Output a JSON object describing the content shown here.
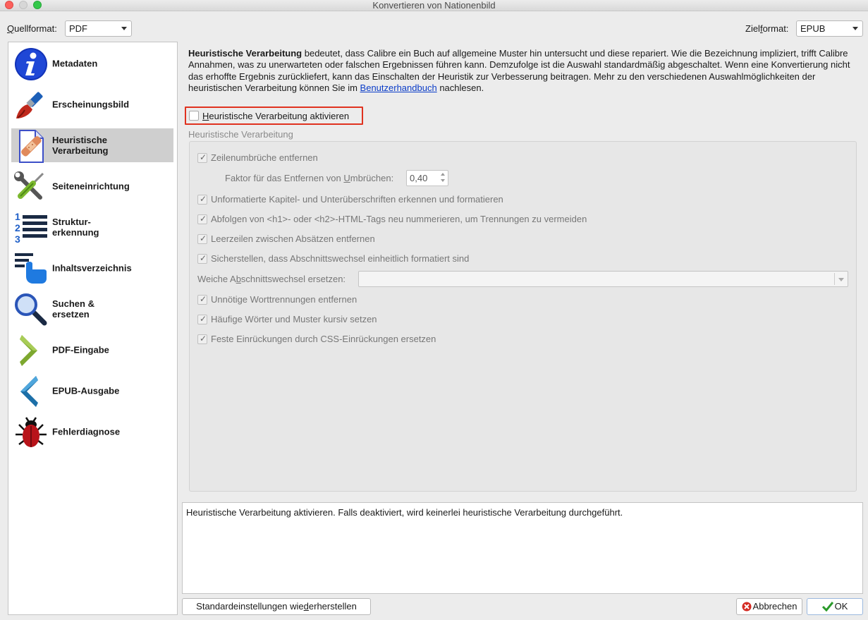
{
  "window": {
    "title": "Konvertieren von Nationenbild"
  },
  "formats": {
    "source_label_accel": "Q",
    "source_label_rest": "uellformat:",
    "source_value": "PDF",
    "target_label_pre": "Ziel",
    "target_label_accel": "f",
    "target_label_post": "ormat:",
    "target_value": "EPUB"
  },
  "sidebar": {
    "items": [
      {
        "label": "Metadaten",
        "icon": "info-icon"
      },
      {
        "label": "Erscheinungsbild",
        "icon": "paintbrush-icon"
      },
      {
        "label": "Heuristische\nVerarbeitung",
        "icon": "bandaged-page-icon",
        "selected": true
      },
      {
        "label": "Seiteneinrichtung",
        "icon": "wrench-screwdriver-icon"
      },
      {
        "label": "Struktur-\nerkennung",
        "icon": "numbered-list-icon"
      },
      {
        "label": "Inhaltsverzeichnis",
        "icon": "toc-hand-icon"
      },
      {
        "label": "Suchen &\nersetzen",
        "icon": "magnifier-icon"
      },
      {
        "label": "PDF-Eingabe",
        "icon": "arrow-right-icon"
      },
      {
        "label": "EPUB-Ausgabe",
        "icon": "arrow-left-icon"
      },
      {
        "label": "Fehlerdiagnose",
        "icon": "bug-icon"
      }
    ]
  },
  "intro": {
    "bold": "Heuristische Verarbeitung",
    "text_before_link": " bedeutet, dass Calibre ein Buch auf allgemeine Muster hin untersucht und diese repariert. Wie die Bezeichnung impliziert, trifft Calibre Annahmen, was zu unerwarteten oder falschen Ergebnissen führen kann. Demzufolge ist die Auswahl standardmäßig abgeschaltet. Wenn eine Konvertierung nicht das erhoffte Ergebnis zurückliefert, kann das Einschalten der Heuristik zur Verbesserung beitragen. Mehr zu den verschiedenen Auswahlmöglichkeiten der heuristischen Verarbeitung können Sie im ",
    "link": "Benutzerhandbuch",
    "text_after_link": " nachlesen."
  },
  "enable": {
    "accel": "H",
    "rest": "euristische Verarbeitung aktivieren",
    "checked": false
  },
  "group": {
    "title": "Heuristische Verarbeitung",
    "options": [
      {
        "label": "Zeilenumbrüche entfernen",
        "checked": true
      },
      {
        "label": "Unformatierte Kapitel- und Unterüberschriften erkennen und formatieren",
        "checked": true
      },
      {
        "label": "Abfolgen von <h1>- oder <h2>-HTML-Tags neu nummerieren, um Trennungen zu vermeiden",
        "checked": true
      },
      {
        "label": "Leerzeilen zwischen Absätzen entfernen",
        "checked": true
      },
      {
        "label": "Sicherstellen, dass Abschnittswechsel einheitlich formatiert sind",
        "checked": true
      },
      {
        "label": "Unnötige Worttrennungen entfernen",
        "checked": true
      },
      {
        "label": "Häufige Wörter und Muster kursiv setzen",
        "checked": true
      },
      {
        "label": "Feste Einrückungen durch CSS-Einrückungen ersetzen",
        "checked": true
      }
    ],
    "factor_label_pre": "Faktor für das Entfernen von ",
    "factor_label_accel": "U",
    "factor_label_post": "mbrüchen:",
    "factor_value": "0,40",
    "soft_break_label_pre": "Weiche A",
    "soft_break_label_accel": "b",
    "soft_break_label_post": "schnittswechsel ersetzen:",
    "soft_break_value": ""
  },
  "help": {
    "text": "Heuristische Verarbeitung aktivieren. Falls deaktiviert, wird keinerlei heuristische Verarbeitung durchgeführt."
  },
  "buttons": {
    "restore_pre": "Standardeinstellungen wie",
    "restore_accel": "d",
    "restore_post": "erherstellen",
    "cancel": "Abbrechen",
    "ok": "OK"
  },
  "colors": {
    "highlight_border": "#e0321f",
    "link": "#0a3cc8",
    "selected_item_bg": "#cfcfcf"
  }
}
